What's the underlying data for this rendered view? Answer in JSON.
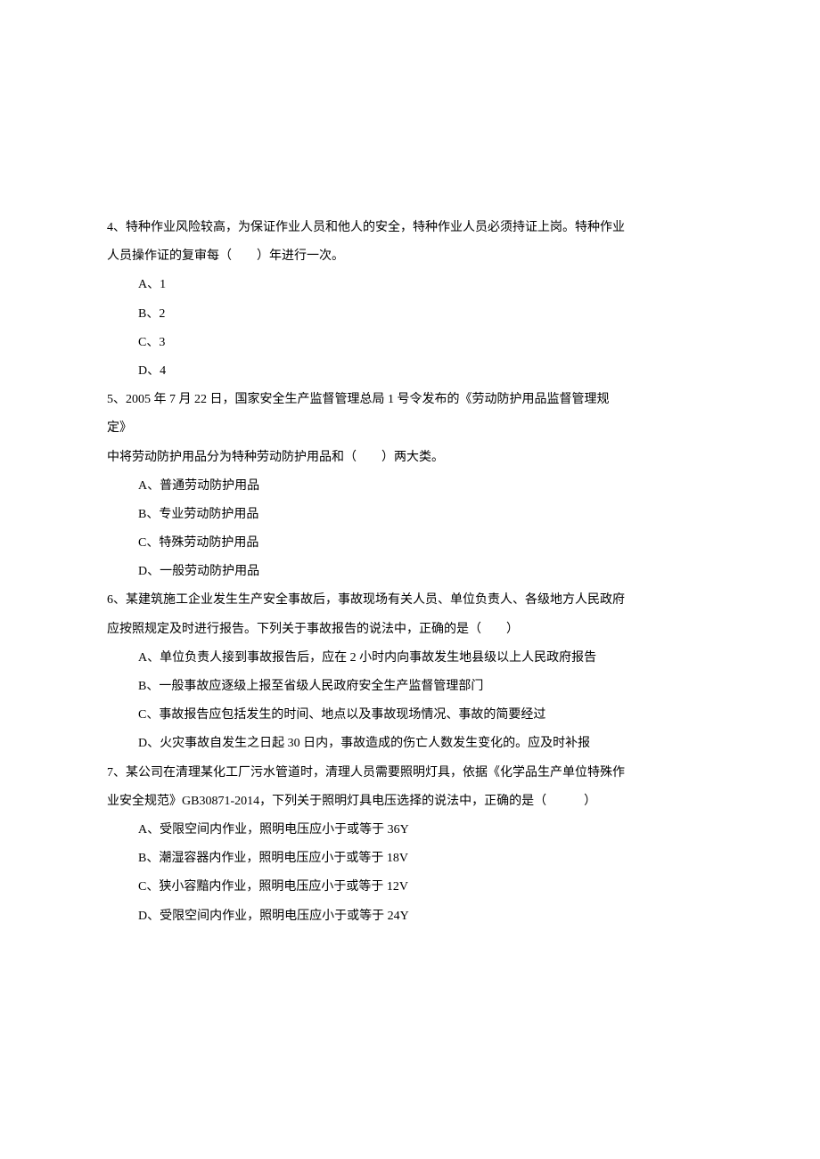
{
  "questions": [
    {
      "stem_lines": [
        "4、特种作业风险较高，为保证作业人员和他人的安全，特种作业人员必须持证上岗。特种作业",
        "人员操作证的复审每（　　）年进行一次。"
      ],
      "options": [
        "A、1",
        "B、2",
        "C、3",
        "D、4"
      ]
    },
    {
      "stem_lines": [
        "5、2005 年 7 月 22 日，国家安全生产监督管理总局 1 号令发布的《劳动防护用品监督管理规",
        "定》",
        "中将劳动防护用品分为特种劳动防护用品和（　　）两大类。"
      ],
      "options": [
        "A、普通劳动防护用品",
        "B、专业劳动防护用品",
        "C、特殊劳动防护用品",
        "D、一般劳动防护用品"
      ]
    },
    {
      "stem_lines": [
        "6、某建筑施工企业发生生产安全事故后，事故现场有关人员、单位负责人、各级地方人民政府",
        "应按照规定及时进行报告。下列关于事故报告的说法中，正确的是（　　）"
      ],
      "options": [
        "A、单位负责人接到事故报告后，应在 2 小时内向事故发生地县级以上人民政府报告",
        "B、一般事故应逐级上报至省级人民政府安全生产监督管理部门",
        "C、事故报告应包括发生的时间、地点以及事故现场情况、事故的简要经过",
        "D、火灾事故自发生之日起 30 日内，事故造成的伤亡人数发生变化的。应及时补报"
      ]
    },
    {
      "stem_lines": [
        "7、某公司在清理某化工厂污水管道时，清理人员需要照明灯具，依据《化学品生产单位特殊作",
        "业安全规范》GB30871-2014，下列关于照明灯具电压选择的说法中，正确的是（　　　）"
      ],
      "options": [
        "A、受限空间内作业，照明电压应小于或等于 36Y",
        "B、潮湿容器内作业，照明电压应小于或等于 18V",
        "C、狭小容黯内作业，照明电压应小于或等于 12V",
        "D、受限空间内作业，照明电压应小于或等于 24Y"
      ]
    }
  ]
}
